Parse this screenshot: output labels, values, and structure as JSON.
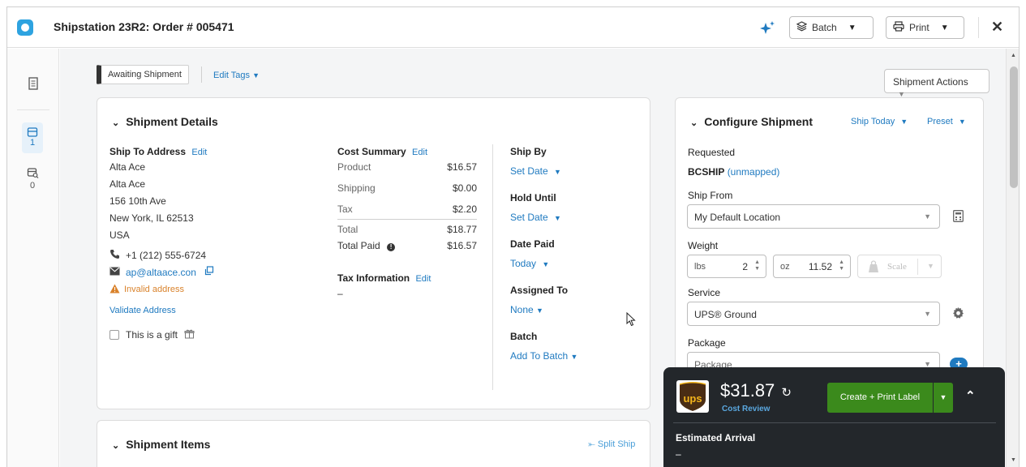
{
  "window": {
    "title": "Shipstation 23R2:  Order # 005471"
  },
  "toolbar": {
    "batch_label": "Batch",
    "print_label": "Print",
    "sparkle_icon": "sparkle-icon",
    "close_icon": "close-icon"
  },
  "rail": {
    "items": [
      {
        "icon": "document-icon",
        "count": ""
      },
      {
        "icon": "package-icon",
        "count": "1"
      },
      {
        "icon": "package-search-icon",
        "count": "0"
      }
    ]
  },
  "status": {
    "badge": "Awaiting Shipment",
    "edit_tags": "Edit Tags",
    "shipment_actions": "Shipment Actions"
  },
  "shipment_details": {
    "title": "Shipment Details",
    "ship_to": {
      "label": "Ship To Address",
      "edit": "Edit",
      "lines": [
        "Alta Ace",
        "Alta Ace",
        "156 10th Ave",
        "New York, IL 62513",
        "USA"
      ],
      "phone": "+1 (212) 555-6724",
      "email": "ap@altaace.con",
      "warning": "Invalid address",
      "validate": "Validate Address",
      "gift": "This is a gift"
    },
    "cost_summary": {
      "label": "Cost Summary",
      "edit": "Edit",
      "rows": [
        {
          "label": "Product",
          "value": "$16.57"
        },
        {
          "label": "Shipping",
          "value": "$0.00"
        },
        {
          "label": "Tax",
          "value": "$2.20"
        },
        {
          "label": "Total",
          "value": "$18.77"
        },
        {
          "label": "Total Paid",
          "value": "$16.57"
        }
      ],
      "tax_info_label": "Tax Information",
      "tax_info_edit": "Edit",
      "tax_info_value": "–"
    },
    "dates": {
      "ship_by_label": "Ship By",
      "ship_by_value": "Set Date",
      "hold_until_label": "Hold Until",
      "hold_until_value": "Set Date",
      "date_paid_label": "Date Paid",
      "date_paid_value": "Today",
      "assigned_to_label": "Assigned To",
      "assigned_to_value": "None",
      "batch_label": "Batch",
      "batch_value": "Add To Batch"
    }
  },
  "shipment_items": {
    "title": "Shipment Items",
    "split_ship": "Split Ship"
  },
  "configure": {
    "title": "Configure Shipment",
    "ship_today": "Ship Today",
    "preset": "Preset",
    "requested_label": "Requested",
    "requested_code": "BCSHIP",
    "requested_unmapped": "(unmapped)",
    "ship_from_label": "Ship From",
    "ship_from_value": "My Default Location",
    "weight_label": "Weight",
    "lbs_unit": "lbs",
    "lbs_value": "2",
    "oz_unit": "oz",
    "oz_value": "11.52",
    "scale_label": "Scale",
    "service_label": "Service",
    "service_value": "UPS® Ground",
    "package_label": "Package",
    "package_value": "Package"
  },
  "rate_panel": {
    "carrier": "ups",
    "price": "$31.87",
    "cost_review": "Cost Review",
    "create_label": "Create + Print Label",
    "estimated_arrival_label": "Estimated Arrival",
    "estimated_arrival_value": "–"
  },
  "colors": {
    "link": "#1f7ac0",
    "warning": "#d9822b",
    "create_button": "#3b8a1c",
    "dark_panel": "#23272b",
    "ups_brown": "#4a2d14",
    "ups_gold": "#f4b51c"
  }
}
